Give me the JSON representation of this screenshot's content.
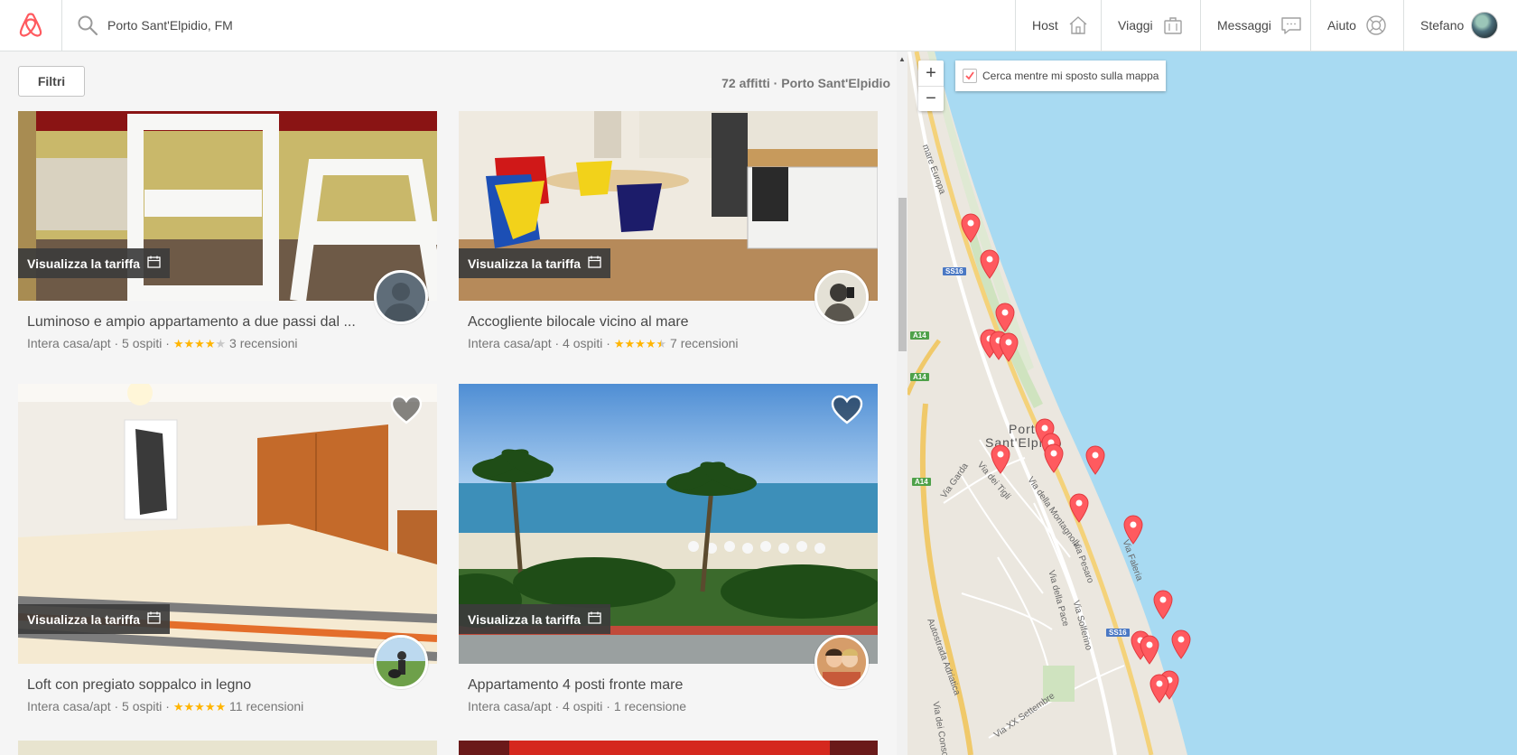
{
  "header": {
    "search_value": "Porto Sant'Elpidio, FM",
    "nav": [
      {
        "label": "Host",
        "icon": "house-icon"
      },
      {
        "label": "Viaggi",
        "icon": "suitcase-icon"
      },
      {
        "label": "Messaggi",
        "icon": "chat-bubble-icon"
      },
      {
        "label": "Aiuto",
        "icon": "lifebuoy-icon"
      }
    ],
    "user_name": "Stefano"
  },
  "filters": {
    "button_label": "Filtri",
    "result_count": "72 affitti · Porto Sant'Elpidio"
  },
  "listings": [
    {
      "badge": "Visualizza la tariffa",
      "title": "Luminoso e ampio appartamento a due passi dal ...",
      "type": "Intera casa/apt · 5 ospiti ·",
      "rating": 4,
      "reviews": "3 recensioni"
    },
    {
      "badge": "Visualizza la tariffa",
      "title": "Accogliente bilocale vicino al mare",
      "type": "Intera casa/apt · 4 ospiti ·",
      "rating": 4.5,
      "reviews": "7 recensioni"
    },
    {
      "badge": "Visualizza la tariffa",
      "title": "Loft con pregiato soppalco in legno",
      "type": "Intera casa/apt · 5 ospiti ·",
      "rating": 5,
      "reviews": "11 recensioni"
    },
    {
      "badge": "Visualizza la tariffa",
      "title": "Appartamento 4 posti fronte mare",
      "type": "Intera casa/apt · 4 ospiti · 1 recensione",
      "rating": null,
      "reviews": ""
    }
  ],
  "map": {
    "zoom_in": "+",
    "zoom_out": "−",
    "search_as_move": "Cerca mentre mi sposto sulla mappa",
    "search_as_move_checked": true,
    "city_label_1": "Porto",
    "city_label_2": "Sant'Elpidio",
    "streets": [
      "Via Garda",
      "Via dei Tigli",
      "Via della Montagnola",
      "Via Pesaro",
      "Via Faleria",
      "Via della Pace",
      "Via Solferino",
      "Autostrada Adriatica",
      "Via XX Settembre",
      "Via dei Conso",
      "mare Europa"
    ],
    "shields": [
      "SS16",
      "A14",
      "A14",
      "A14",
      "SS16"
    ],
    "marker_count": 19
  },
  "colors": {
    "brand": "#ff5a5f",
    "star": "#ffb400",
    "sea": "#a8daf2",
    "land": "#ebe7df"
  }
}
